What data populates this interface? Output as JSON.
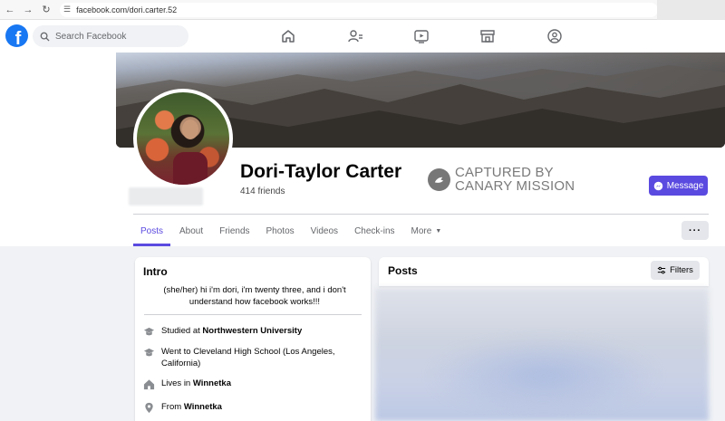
{
  "browser": {
    "url": "facebook.com/dori.carter.52"
  },
  "topbar": {
    "search_placeholder": "Search Facebook",
    "nav_icons": [
      "home-icon",
      "friends-icon",
      "watch-icon",
      "marketplace-icon",
      "groups-icon"
    ]
  },
  "profile": {
    "name": "Dori-Taylor Carter",
    "friends": "414 friends",
    "message_label": "Message"
  },
  "watermark": {
    "line1": "CAPTURED BY",
    "line2": "CANARY MISSION"
  },
  "tabs": [
    {
      "label": "Posts"
    },
    {
      "label": "About"
    },
    {
      "label": "Friends"
    },
    {
      "label": "Photos"
    },
    {
      "label": "Videos"
    },
    {
      "label": "Check-ins"
    },
    {
      "label": "More"
    }
  ],
  "more_menu_label": "···",
  "intro": {
    "title": "Intro",
    "bio": "(she/her) hi i'm dori, i'm twenty three, and i don't understand how facebook works!!!",
    "items": [
      {
        "icon": "graduation-cap-icon",
        "prefix": "Studied at ",
        "bold": "Northwestern University"
      },
      {
        "icon": "graduation-cap-icon",
        "prefix": "Went to Cleveland High School (Los Angeles, California)",
        "bold": ""
      },
      {
        "icon": "home-icon",
        "prefix": "Lives in ",
        "bold": "Winnetka"
      },
      {
        "icon": "location-pin-icon",
        "prefix": "From ",
        "bold": "Winnetka"
      }
    ]
  },
  "posts": {
    "title": "Posts",
    "filters_label": "Filters"
  },
  "colors": {
    "accent": "#5b4ae0",
    "facebook_blue": "#1877f2"
  }
}
